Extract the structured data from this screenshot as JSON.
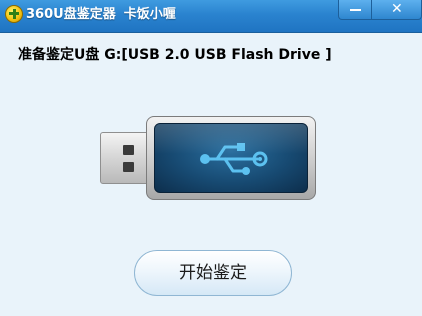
{
  "window": {
    "title": "360U盘鉴定器",
    "title_extra": "卡饭小喱",
    "close_glyph": "✕"
  },
  "status": {
    "text": "准备鉴定U盘 G:[USB 2.0 USB Flash Drive ]"
  },
  "actions": {
    "start_label": "开始鉴定"
  },
  "icons": {
    "app": "360-logo-icon",
    "usb_drive": "usb-drive-icon",
    "usb_symbol": "usb-symbol-icon"
  },
  "colors": {
    "titlebar": "#2a83cf",
    "background": "#e9f3fa",
    "usb_panel": "#174a72",
    "usb_symbol": "#5cc1f0"
  }
}
